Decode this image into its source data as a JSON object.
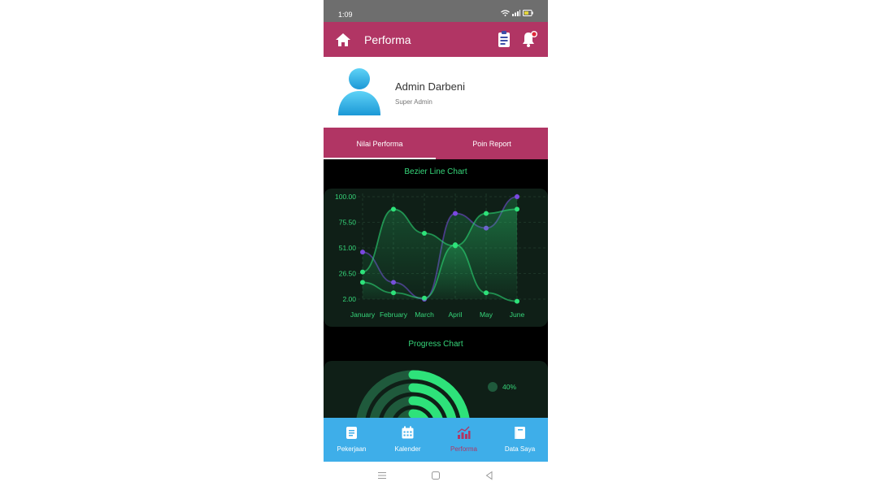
{
  "status_bar": {
    "time": "1:09"
  },
  "app_bar": {
    "title": "Performa",
    "colors": {
      "primary": "#b13564"
    }
  },
  "profile": {
    "name": "Admin Darbeni",
    "role": "Super Admin"
  },
  "tabs": [
    {
      "label": "Nilai Performa",
      "active": true
    },
    {
      "label": "Poin Report",
      "active": false
    }
  ],
  "bezier_section": {
    "title": "Bezier Line Chart"
  },
  "chart_data": {
    "type": "line",
    "title": "Bezier Line Chart",
    "categories": [
      "January",
      "February",
      "March",
      "April",
      "May",
      "June"
    ],
    "y_ticks": [
      "100.00",
      "75.50",
      "51.00",
      "26.50",
      "2.00"
    ],
    "ylim": [
      2,
      100
    ],
    "grid": true,
    "series": [
      {
        "color": "#7a48e0",
        "values": [
          47,
          18,
          2,
          84,
          70,
          100
        ]
      },
      {
        "color": "#2ee27a",
        "values": [
          28,
          88,
          65,
          53,
          84,
          88
        ]
      },
      {
        "color": "#2ee27a",
        "values": [
          18,
          8,
          3,
          54,
          8,
          0
        ]
      }
    ]
  },
  "progress_section": {
    "title": "Progress Chart",
    "legend_label": "40%",
    "rings": [
      0.4,
      0.55,
      0.65,
      0.75
    ]
  },
  "bottom_nav": [
    {
      "label": "Pekerjaan",
      "icon": "clipboard-icon",
      "active": false
    },
    {
      "label": "Kalender",
      "icon": "calendar-icon",
      "active": false
    },
    {
      "label": "Performa",
      "icon": "chart-icon",
      "active": true
    },
    {
      "label": "Data Saya",
      "icon": "book-icon",
      "active": false
    }
  ]
}
